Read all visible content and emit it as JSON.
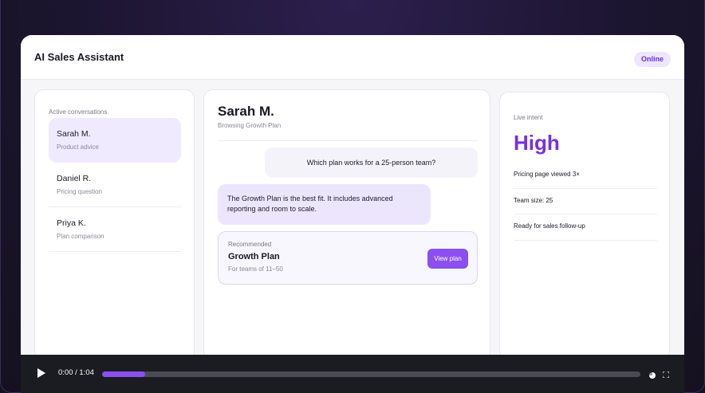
{
  "app": {
    "title": "AI Sales Assistant",
    "status": "Online"
  },
  "conversations": {
    "label": "Active conversations",
    "items": [
      {
        "name": "Sarah M.",
        "subtitle": "Product advice",
        "active": true
      },
      {
        "name": "Daniel R.",
        "subtitle": "Pricing question",
        "active": false
      },
      {
        "name": "Priya K.",
        "subtitle": "Plan comparison",
        "active": false
      }
    ]
  },
  "chat": {
    "name": "Sarah M.",
    "subtitle": "Browsing Growth Plan",
    "messages": [
      {
        "from": "user",
        "text": "Which plan works for a 25-person team?"
      },
      {
        "from": "assistant",
        "text": "The Growth Plan is the best fit. It includes advanced reporting and room to scale."
      }
    ],
    "recommendation": {
      "label": "Recommended",
      "title": "Growth Plan",
      "subtitle": "For teams of 11–50",
      "button": "View plan"
    }
  },
  "intent": {
    "label": "Live intent",
    "value": "High",
    "signals": [
      "Pricing page viewed 3×",
      "Team size: 25",
      "Ready for sales follow-up"
    ]
  },
  "player": {
    "time": "0:00 / 1:04",
    "progress_fraction": 0.08
  },
  "colors": {
    "accent": "#8b4ff0",
    "intent": "#7a2fe0",
    "active_bg": "#efeafe"
  },
  "icons": [
    "play-icon",
    "volume-icon",
    "fullscreen-icon"
  ]
}
